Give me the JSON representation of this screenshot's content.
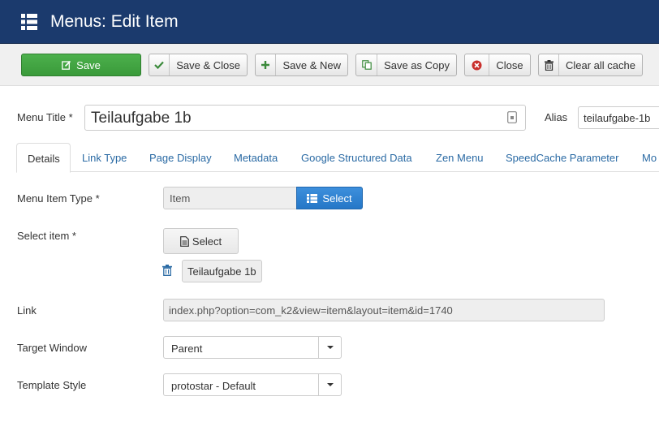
{
  "header": {
    "title": "Menus: Edit Item",
    "icon": "list-icon"
  },
  "toolbar": {
    "save_label": "Save",
    "save_close_label": "Save & Close",
    "save_new_label": "Save & New",
    "save_copy_label": "Save as Copy",
    "close_label": "Close",
    "clear_cache_label": "Clear all cache",
    "colors": {
      "save": "#3fa13f",
      "check": "#3b8a3b",
      "plus": "#3b8a3b",
      "close": "#c9302c"
    }
  },
  "form": {
    "menu_title_label": "Menu Title *",
    "menu_title_value": "Teilaufgabe 1b",
    "alias_label": "Alias",
    "alias_value": "teilaufgabe-1b",
    "menu_item_type_label": "Menu Item Type *",
    "menu_item_type_value": "Item",
    "menu_item_type_select": "Select",
    "select_item_label": "Select item *",
    "select_item_button": "Select",
    "selected_item": "Teilaufgabe 1b",
    "link_label": "Link",
    "link_value": "index.php?option=com_k2&view=item&layout=item&id=1740",
    "target_window_label": "Target Window",
    "target_window_value": "Parent",
    "template_style_label": "Template Style",
    "template_style_value": "protostar - Default"
  },
  "tabs": [
    {
      "label": "Details",
      "active": true
    },
    {
      "label": "Link Type"
    },
    {
      "label": "Page Display"
    },
    {
      "label": "Metadata"
    },
    {
      "label": "Google Structured Data"
    },
    {
      "label": "Zen Menu"
    },
    {
      "label": "SpeedCache Parameter"
    },
    {
      "label": "Mo"
    }
  ]
}
